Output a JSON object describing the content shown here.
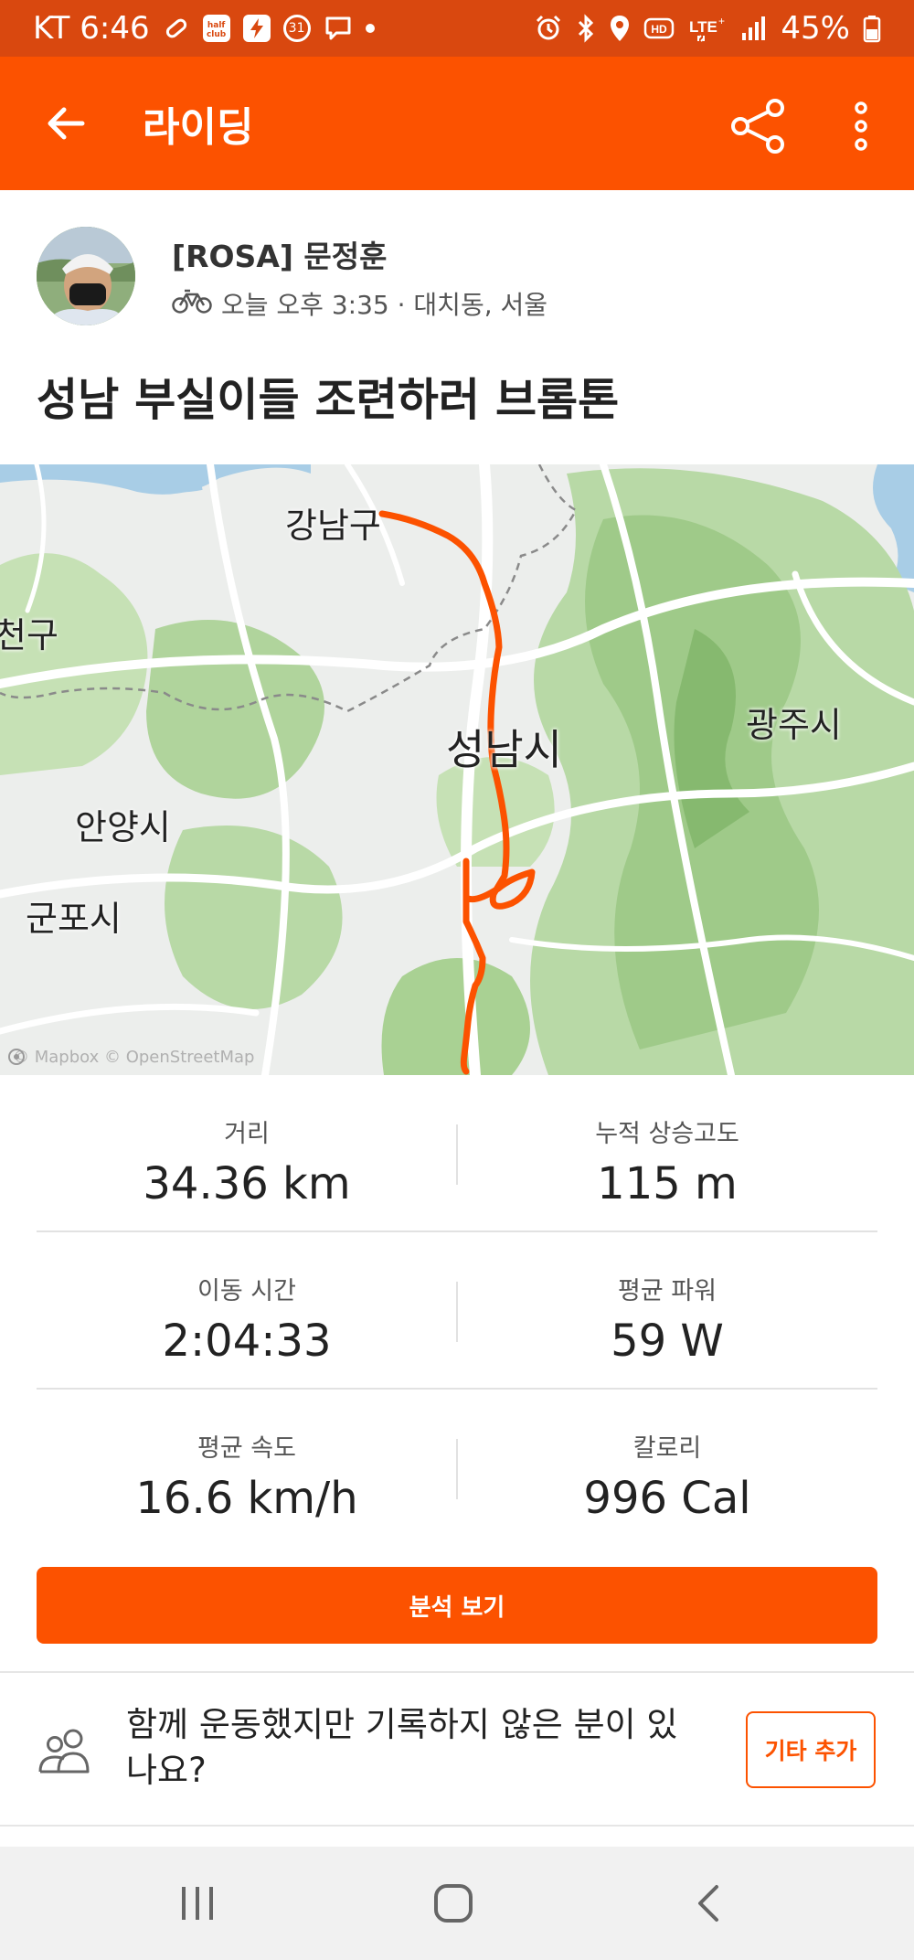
{
  "status_bar": {
    "carrier_time": "KT 6:46",
    "battery": "45%",
    "left_icons": [
      "bandage-icon",
      "halfclub-app-icon",
      "bolt-app-icon",
      "calendar-31-icon",
      "chat-icon",
      "dot-icon"
    ],
    "right_icons": [
      "alarm-icon",
      "bluetooth-icon",
      "location-icon",
      "hd-icon",
      "lte-icon",
      "signal-icon",
      "battery-icon"
    ],
    "halfclub_text": "half club",
    "calendar_text": "31"
  },
  "app_bar": {
    "title": "라이딩",
    "icons": [
      "back-arrow-icon",
      "share-icon",
      "more-vertical-icon"
    ]
  },
  "athlete": {
    "name": "[ROSA] 문정훈",
    "meta": "오늘 오후 3:35 · 대치동, 서울",
    "activity_icon": "bicycle-icon"
  },
  "activity": {
    "title": "성남 부실이들 조련하러 브롬톤"
  },
  "map": {
    "labels": {
      "gangnam": "강남구",
      "seocho_partial": "천구",
      "seongnam": "성남시",
      "gwangju": "광주시",
      "anyang": "안양시",
      "gunpo": "군포시"
    },
    "attribution": "© Mapbox © OpenStreetMap",
    "route_color": "#fc5200"
  },
  "stats": [
    {
      "label": "거리",
      "value": "34.36 km"
    },
    {
      "label": "누적 상승고도",
      "value": "115 m"
    },
    {
      "label": "이동 시간",
      "value": "2:04:33"
    },
    {
      "label": "평균 파워",
      "value": "59 W"
    },
    {
      "label": "평균 속도",
      "value": "16.6 km/h"
    },
    {
      "label": "칼로리",
      "value": "996 Cal"
    }
  ],
  "analysis_button": "분석 보기",
  "together": {
    "message": "함께 운동했지만 기록하지 않은 분이 있나요?",
    "button": "기타 추가"
  },
  "colors": {
    "brand": "#fc5200",
    "status_bar": "#d9480f"
  },
  "nav_bar": {
    "icons": [
      "recent-apps-icon",
      "home-icon",
      "nav-back-icon"
    ]
  }
}
